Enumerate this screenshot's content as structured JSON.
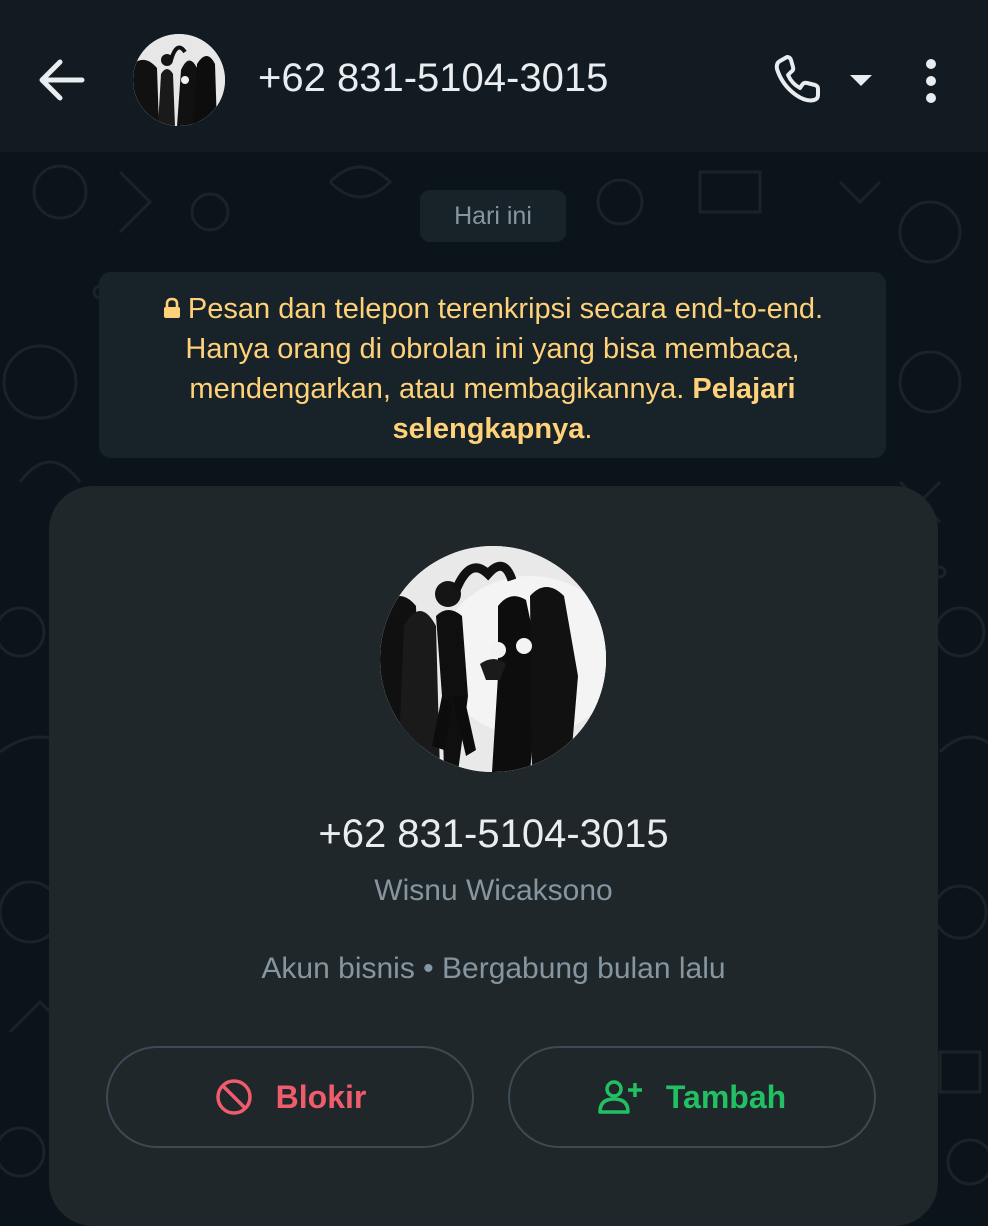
{
  "header": {
    "title": "+62 831-5104-3015",
    "icons": [
      "back-arrow-icon",
      "avatar",
      "phone-icon",
      "dropdown-caret-icon",
      "more-vert-icon"
    ]
  },
  "chat": {
    "date_chip": "Hari ini",
    "encryption_notice": {
      "text": "Pesan dan telepon terenkripsi secara end-to-end. Hanya orang di obrolan ini yang bisa membaca, mendengarkan, atau membagikannya.",
      "link": "Pelajari selengkapnya",
      "suffix": "."
    }
  },
  "profile_card": {
    "phone": "+62 831-5104-3015",
    "name": "Wisnu Wicaksono",
    "info": "Akun bisnis • Bergabung bulan lalu",
    "block_label": "Blokir",
    "add_label": "Tambah"
  },
  "colors": {
    "header_bg": "#111b21",
    "chat_bg": "#0b141a",
    "notice_text": "#ffd279",
    "block_red": "#f15c6d",
    "add_green": "#21c063",
    "card_bg": "#1f272a"
  }
}
